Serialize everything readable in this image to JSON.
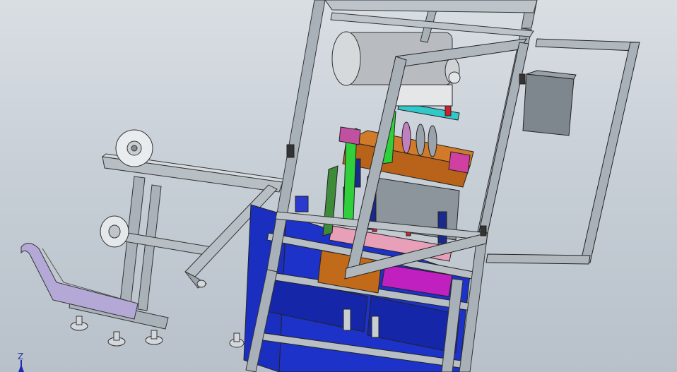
{
  "viewport": {
    "triad": {
      "axis_label": "Z",
      "axis_color": "#1f2bb0"
    }
  },
  "colors": {
    "background": "#c9d1d8",
    "frame": "#9aa3ab",
    "panel_blue": "#1a2fc0",
    "orange": "#c06a1a",
    "green": "#2fd03a",
    "pink": "#e8a0b8",
    "magenta": "#d020d0",
    "navy": "#1a2a8a",
    "gray_cylinder": "#b8bcc0"
  }
}
